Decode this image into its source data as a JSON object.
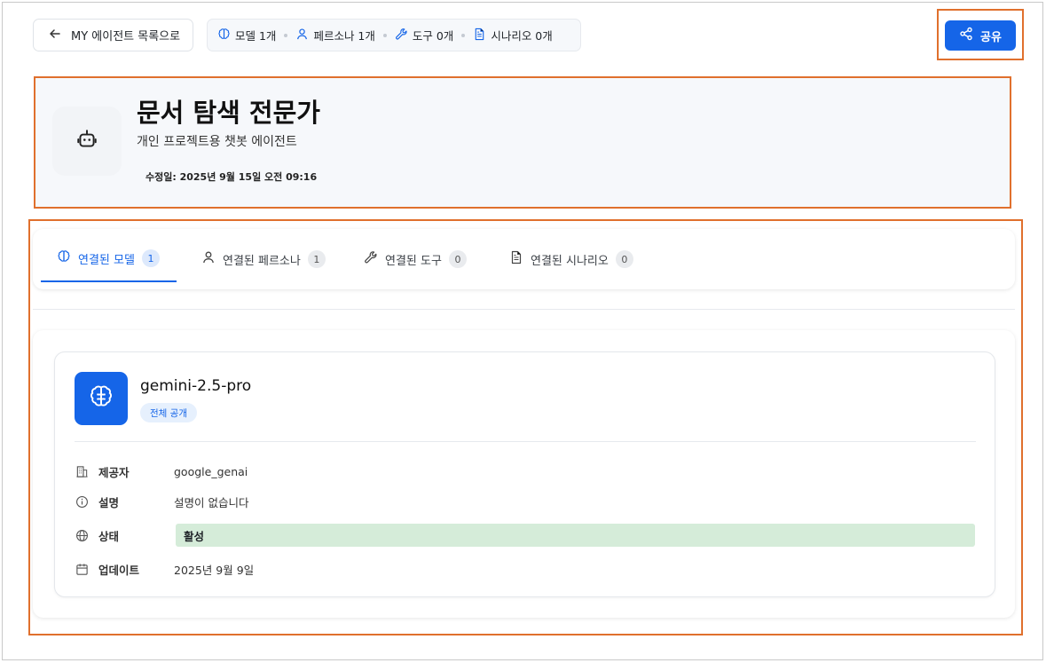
{
  "topbar": {
    "back_label": "MY 에이전트 목록으로",
    "stats": [
      {
        "icon": "brain-icon",
        "label": "모델 1개"
      },
      {
        "icon": "user-icon",
        "label": "페르소나 1개"
      },
      {
        "icon": "wrench-icon",
        "label": "도구 0개"
      },
      {
        "icon": "document-icon",
        "label": "시나리오 0개"
      }
    ],
    "share_label": "공유"
  },
  "agent": {
    "icon": "robot-icon",
    "title": "문서 탐색 전문가",
    "subtitle": "개인 프로젝트용 챗봇 에이전트",
    "modified": "수정일: 2025년 9월 15일 오전 09:16"
  },
  "tabs": [
    {
      "icon": "brain-icon",
      "label": "연결된 모델",
      "count": "1",
      "active": true
    },
    {
      "icon": "user-icon",
      "label": "연결된 페르소나",
      "count": "1",
      "active": false
    },
    {
      "icon": "wrench-icon",
      "label": "연결된 도구",
      "count": "0",
      "active": false
    },
    {
      "icon": "document-icon",
      "label": "연결된 시나리오",
      "count": "0",
      "active": false
    }
  ],
  "model": {
    "icon": "brain-icon",
    "name": "gemini-2.5-pro",
    "visibility": "전체 공개",
    "details": [
      {
        "icon": "building-icon",
        "label": "제공자",
        "value": "google_genai"
      },
      {
        "icon": "info-icon",
        "label": "설명",
        "value": "설명이 없습니다"
      },
      {
        "icon": "globe-icon",
        "label": "상태",
        "value": "활성"
      },
      {
        "icon": "calendar-icon",
        "label": "업데이트",
        "value": "2025년 9월 9일"
      }
    ]
  },
  "colors": {
    "accent": "#1565e8",
    "highlight_border": "#e0702d",
    "status_active_bg": "#d5ecd9"
  }
}
